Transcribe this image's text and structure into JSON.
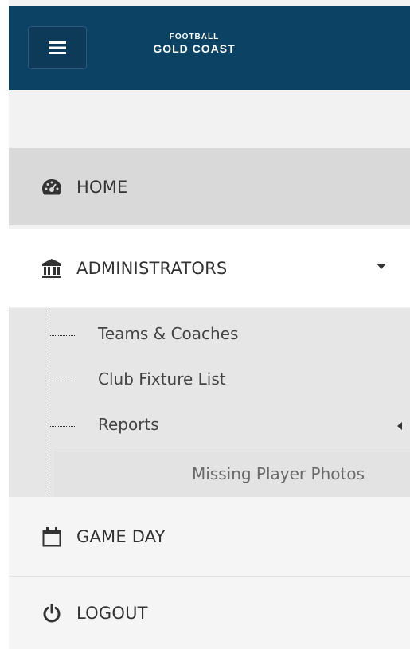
{
  "header": {
    "logo_line1": "FOOTBALL",
    "logo_line2": "GOLD COAST",
    "menu_icon": "hamburger-icon",
    "background_color": "#0c4364"
  },
  "nav": {
    "home": {
      "label": "HOME",
      "icon": "dashboard-icon"
    },
    "administrators": {
      "label": "ADMINISTRATORS",
      "icon": "bank-icon",
      "expanded": true,
      "children": [
        {
          "label": "Teams & Coaches"
        },
        {
          "label": "Club Fixture List"
        },
        {
          "label": "Reports",
          "expanded": true,
          "children": [
            {
              "label": "Missing Player Photos"
            }
          ]
        }
      ]
    },
    "game_day": {
      "label": "GAME DAY",
      "icon": "calendar-icon"
    },
    "logout": {
      "label": "LOGOUT",
      "icon": "power-icon"
    }
  }
}
